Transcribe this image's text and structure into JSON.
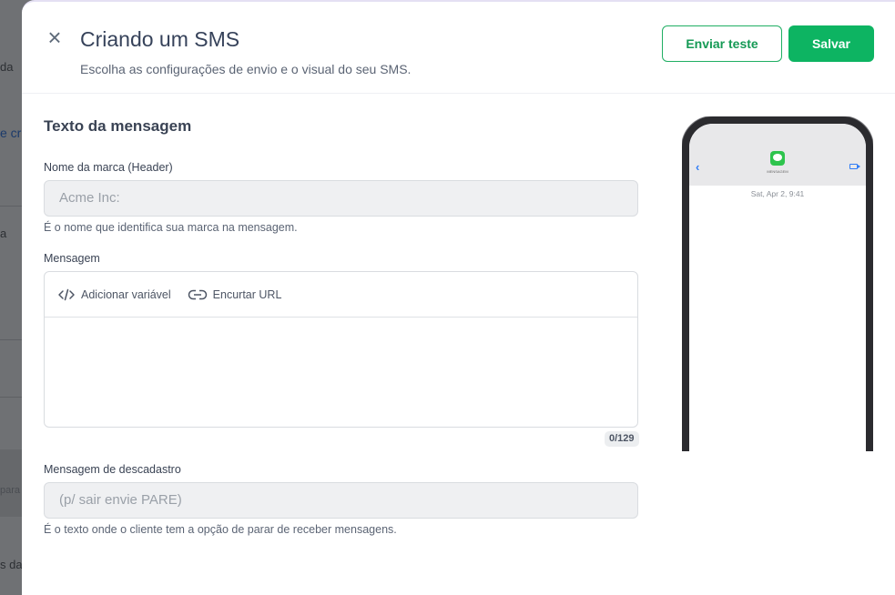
{
  "background": {
    "fragments": [
      "da",
      "e cri",
      "a",
      "para",
      "s da"
    ]
  },
  "drawer": {
    "title": "Criando um SMS",
    "subtitle": "Escolha as configurações de envio e o visual do seu SMS.",
    "buttons": {
      "send_test": "Enviar teste",
      "save": "Salvar"
    },
    "section_title": "Texto da mensagem",
    "brand_field": {
      "label": "Nome da marca (Header)",
      "value": "Acme Inc:",
      "help": "É o nome que identifica sua marca na mensagem."
    },
    "message_field": {
      "label": "Mensagem",
      "toolbar": {
        "add_variable": "Adicionar variável",
        "shorten_url": "Encurtar URL"
      },
      "value": "",
      "counter": "0/129"
    },
    "unsubscribe_field": {
      "label": "Mensagem de descadastro",
      "value": "(p/ sair envie PARE)",
      "help": "É o texto onde o cliente tem a opção de parar de receber mensagens."
    },
    "phone_preview": {
      "contact": "MENSAGEM",
      "timestamp": "Sat, Apr 2, 9:41"
    }
  },
  "colors": {
    "primary": "#0db462",
    "primary_text": "#159a55",
    "title": "#36425a",
    "ios_blue": "#2f7cf6"
  }
}
